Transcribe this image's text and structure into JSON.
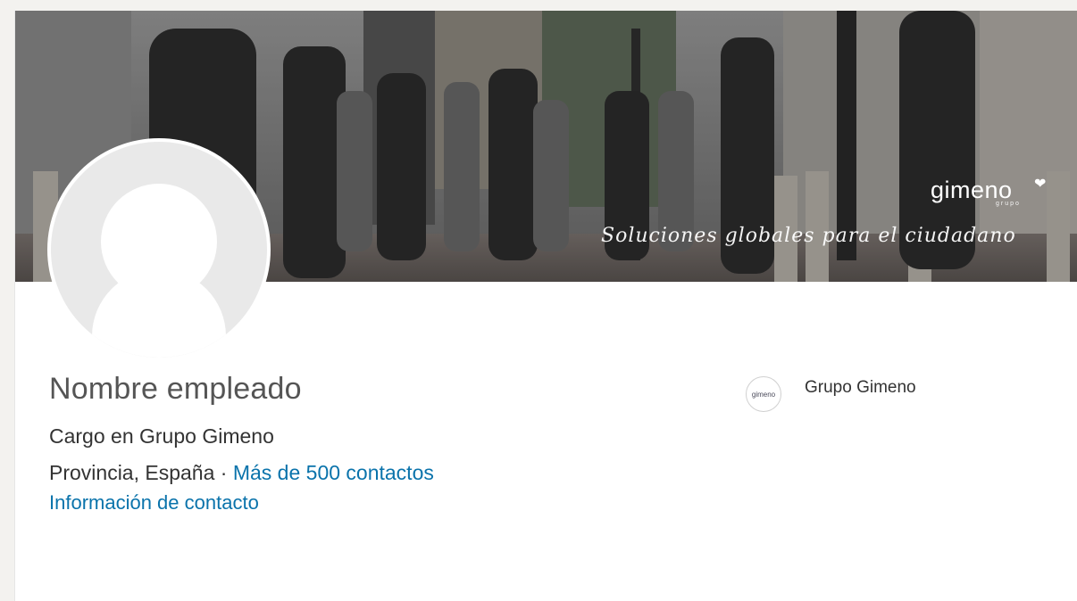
{
  "banner": {
    "brand_name": "gimeno",
    "brand_sub": "grupo",
    "brand_mark": "❤",
    "tagline": "Soluciones globales para el ciudadano"
  },
  "profile": {
    "name": "Nombre empleado",
    "headline": "Cargo en Grupo Gimeno",
    "location": "Provincia, España",
    "separator": "·",
    "contacts_link": "Más de 500 contactos",
    "contact_info_link": "Información de contacto"
  },
  "company": {
    "logo_text": "gimeno",
    "name": "Grupo Gimeno"
  },
  "colors": {
    "link": "#0a73ab",
    "text": "#333333",
    "name": "#555555"
  }
}
